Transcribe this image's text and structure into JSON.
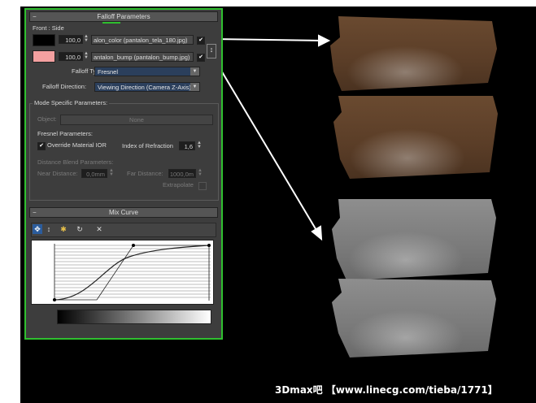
{
  "falloff_rollout": {
    "title": "Falloff Parameters",
    "toggle": "−"
  },
  "front_side": {
    "label": "Front : Side",
    "row1": {
      "amount": "100,0",
      "map": "alon_color (pantalon_tela_180.jpg)",
      "checked": "✔"
    },
    "row2": {
      "amount": "100,0",
      "map": "antalon_bump (pantalon_bump.jpg)",
      "checked": "✔"
    },
    "falloff_type_label": "Falloff Type:",
    "falloff_type_value": "Fresnel",
    "falloff_direction_label": "Falloff Direction:",
    "falloff_direction_value": "Viewing Direction (Camera Z-Axis)"
  },
  "mode_specific": {
    "label": "Mode Specific Parameters:",
    "object_label": "Object:",
    "object_button": "None",
    "fresnel_label": "Fresnel Parameters:",
    "override_label": "Override Material IOR",
    "override_checked": "✔",
    "ior_label": "Index of Refraction",
    "ior_value": "1,6",
    "distance_blend_label": "Distance Blend Parameters:",
    "near_label": "Near Distance:",
    "near_value": "0,0mm",
    "far_label": "Far Distance:",
    "far_value": "1000,0m",
    "extrapolate_label": "Extrapolate"
  },
  "mix_curve_rollout": {
    "title": "Mix Curve",
    "toggle": "−"
  },
  "mix_curve": {
    "y_top": "1",
    "y_bottom": "0",
    "tools": {
      "move": "✥",
      "scale": "↕",
      "add_point": "✱",
      "reset": "↻",
      "delete": "✕"
    }
  },
  "watermark": "3Dmax吧 【www.linecg.com/tieba/1771】",
  "colors": {
    "panel_border": "#2fbf2f",
    "swatch_black": "#000000",
    "swatch_pink": "#f4a0a0"
  }
}
